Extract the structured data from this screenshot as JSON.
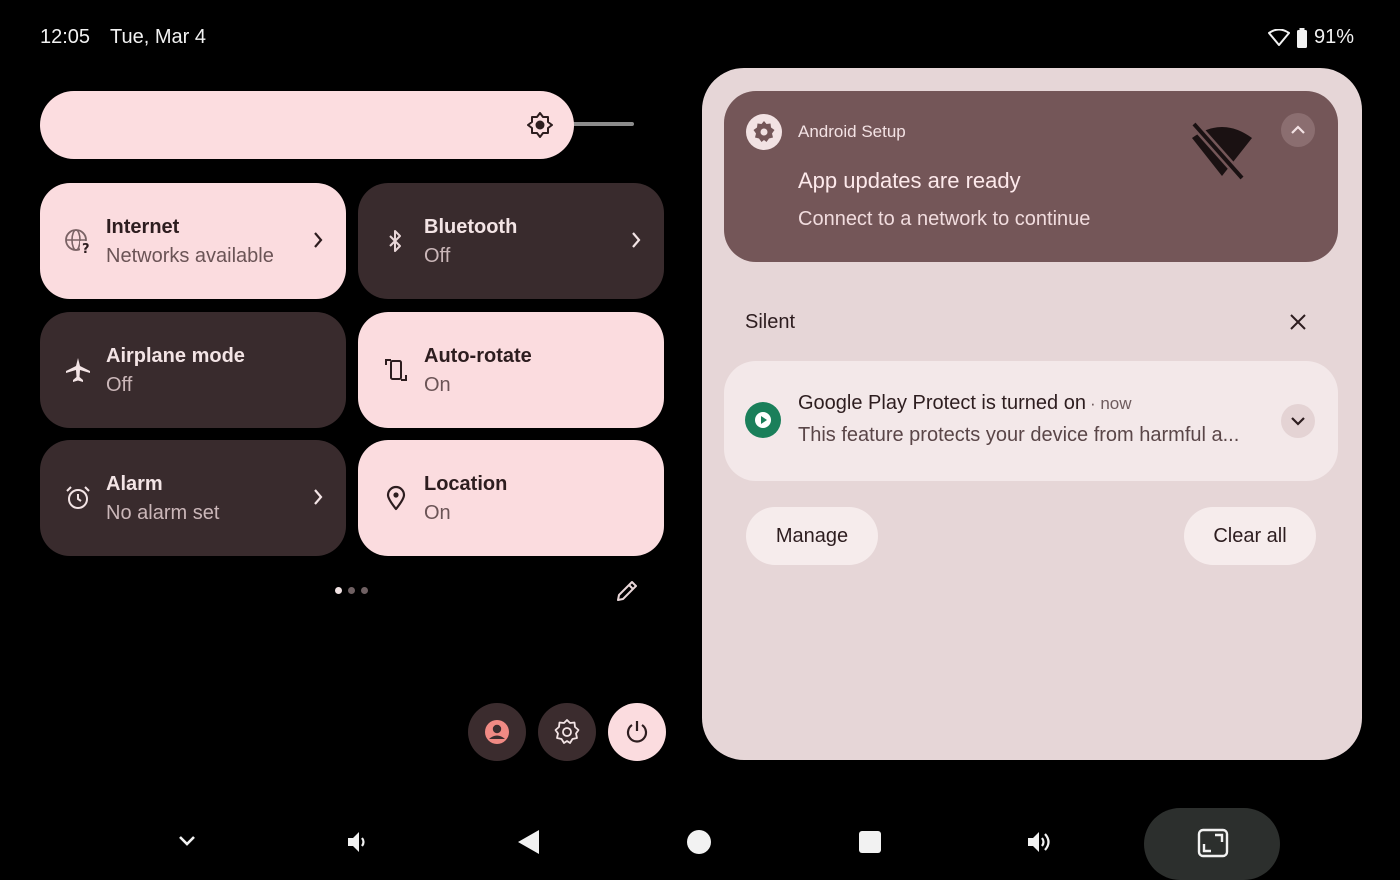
{
  "status_bar": {
    "time": "12:05",
    "date": "Tue, Mar 4",
    "battery": "91%",
    "icons": [
      "wifi-icon",
      "battery-icon"
    ]
  },
  "quick_settings": {
    "brightness": {
      "level": 0.78,
      "icon": "brightness-icon"
    },
    "tiles": [
      {
        "label": "Internet",
        "state": "Networks available",
        "active": true,
        "icon": "globe-question-icon",
        "has_chevron": true
      },
      {
        "label": "Bluetooth",
        "state": "Off",
        "active": false,
        "icon": "bluetooth-icon",
        "has_chevron": true
      },
      {
        "label": "Airplane mode",
        "state": "Off",
        "active": false,
        "icon": "airplane-icon",
        "has_chevron": false
      },
      {
        "label": "Auto-rotate",
        "state": "On",
        "active": true,
        "icon": "auto-rotate-icon",
        "has_chevron": false
      },
      {
        "label": "Alarm",
        "state": "No alarm set",
        "active": false,
        "icon": "alarm-icon",
        "has_chevron": true
      },
      {
        "label": "Location",
        "state": "On",
        "active": true,
        "icon": "location-icon",
        "has_chevron": false
      }
    ],
    "page_indicator": {
      "pages": 3,
      "current": 1
    }
  },
  "notifications": {
    "android_setup": {
      "app_name": "Android Setup",
      "title": "App updates are ready",
      "text": "Connect to a network to continue"
    },
    "silent_header": "Silent",
    "play_protect": {
      "title": "Google Play Protect is turned on",
      "time": "· now",
      "text": "This feature protects your device from harmful a..."
    },
    "manage_label": "Manage",
    "clear_all_label": "Clear all"
  },
  "colors": {
    "tile_on": "#fbdcdf",
    "tile_off": "#392b2d",
    "panel_bg": "#e6d6d7",
    "setup_card": "#745658",
    "play_protect_green": "#1a7f5a"
  }
}
